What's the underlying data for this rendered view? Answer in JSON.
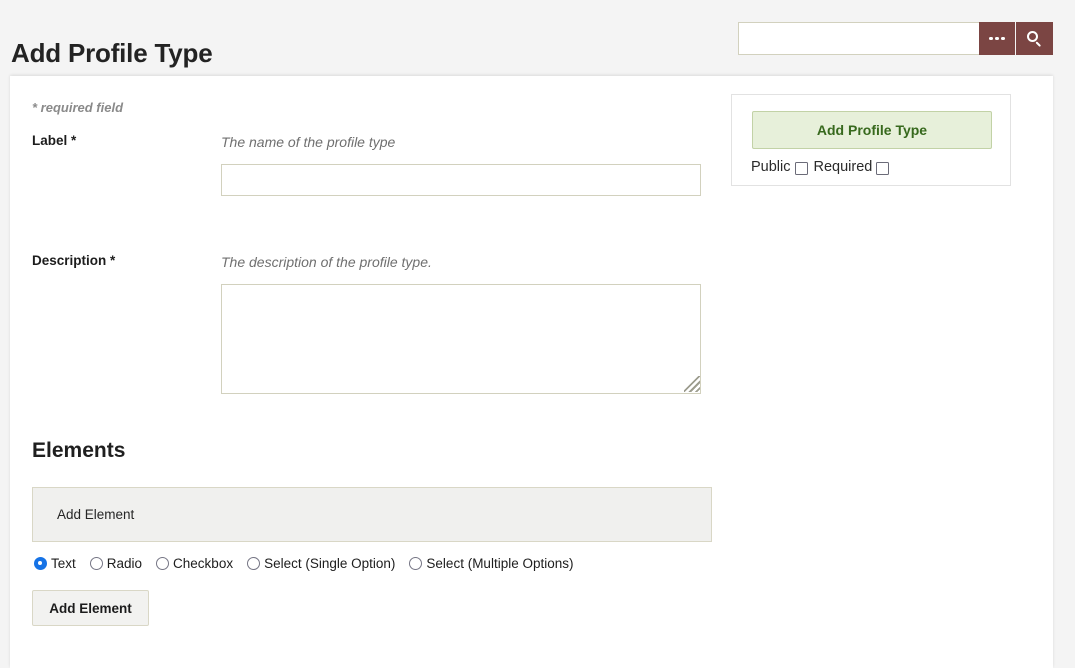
{
  "header": {
    "title": "Add Profile Type",
    "search": {
      "value": "",
      "placeholder": "",
      "more_icon": "ellipsis-icon",
      "search_icon": "search-icon"
    }
  },
  "form": {
    "required_note": "* required field",
    "fields": [
      {
        "label": "Label *",
        "hint": "The name of the profile type",
        "value": "",
        "placeholder": ""
      },
      {
        "label": "Description *",
        "hint": "The description of the profile type.",
        "value": "",
        "placeholder": ""
      }
    ]
  },
  "side_panel": {
    "submit_label": "Add Profile Type",
    "toggles": [
      {
        "label": "Public",
        "checked": false
      },
      {
        "label": "Required",
        "checked": false
      }
    ]
  },
  "elements": {
    "heading": "Elements",
    "add_element_panel_label": "Add Element",
    "type_options": [
      {
        "label": "Text",
        "selected": true
      },
      {
        "label": "Radio",
        "selected": false
      },
      {
        "label": "Checkbox",
        "selected": false
      },
      {
        "label": "Select (Single Option)",
        "selected": false
      },
      {
        "label": "Select (Multiple Options)",
        "selected": false
      }
    ],
    "add_element_button_label": "Add Element"
  },
  "colors": {
    "page_background": "#f4f4f4",
    "card_background": "#ffffff",
    "search_button": "#7b4543",
    "submit_background": "#e7f0da",
    "submit_border": "#c2d2a6",
    "submit_text": "#37691d",
    "input_border": "#d2d1be",
    "radio_selected": "#1673e6"
  }
}
